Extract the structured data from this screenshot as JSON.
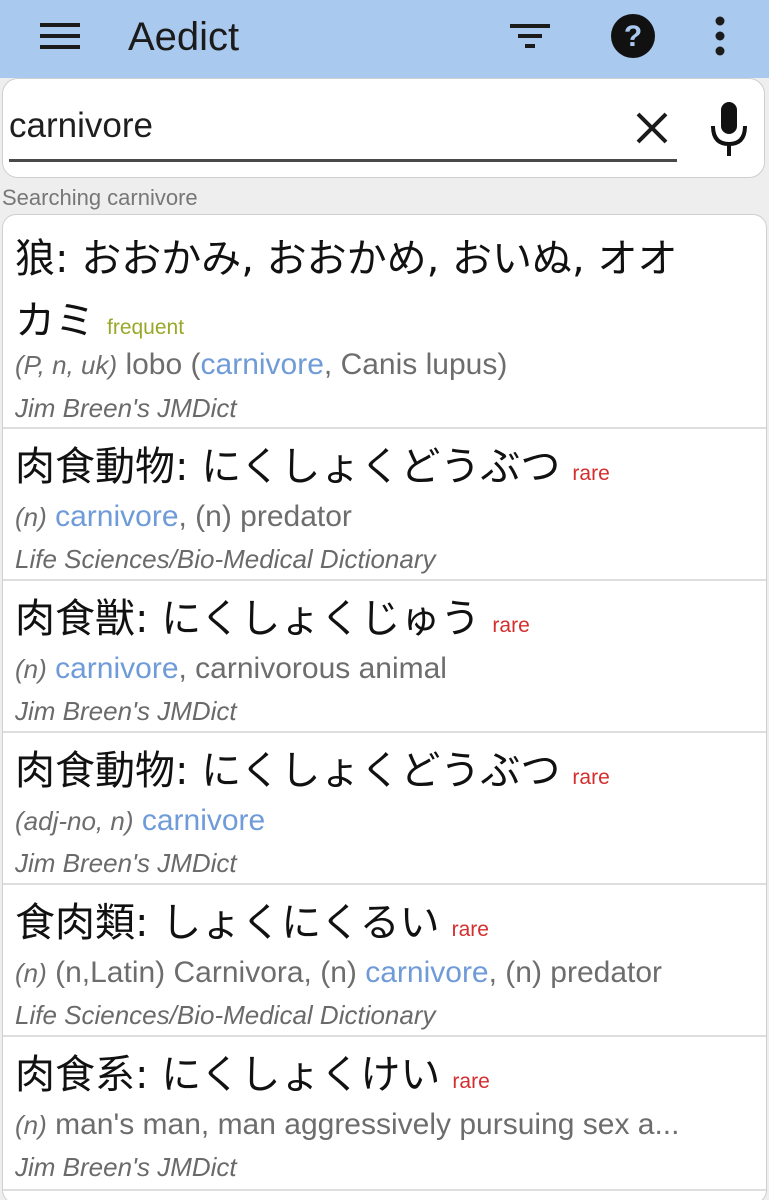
{
  "app": {
    "title": "Aedict"
  },
  "toolbar": {
    "menu_icon": "hamburger-menu-icon",
    "filter_icon": "filter-icon",
    "help_icon": "help-circle-icon",
    "overflow_icon": "more-vertical-icon"
  },
  "search": {
    "value": "carnivore",
    "clear_icon": "close-icon",
    "mic_icon": "microphone-icon"
  },
  "status": {
    "text": "Searching carnivore"
  },
  "results": [
    {
      "headword_line1": "狼: おおかみ, おおかめ, おいぬ, オオ",
      "headword_line2": "カミ",
      "badge": "frequent",
      "sense_pos": "(P, n, uk)",
      "sense_before": " lobo (",
      "sense_highlight": "carnivore",
      "sense_after": ", Canis lupus)",
      "source": "Jim Breen's JMDict"
    },
    {
      "headword_line1": "肉食動物: にくしょくどうぶつ",
      "badge": "rare",
      "sense_pos": "(n)",
      "sense_before": " ",
      "sense_highlight": "carnivore",
      "sense_after": ", (n) predator",
      "source": "Life Sciences/Bio-Medical Dictionary"
    },
    {
      "headword_line1": "肉食獣: にくしょくじゅう",
      "badge": "rare",
      "sense_pos": "(n)",
      "sense_before": " ",
      "sense_highlight": "carnivore",
      "sense_after": ", carnivorous animal",
      "source": "Jim Breen's JMDict"
    },
    {
      "headword_line1": "肉食動物: にくしょくどうぶつ",
      "badge": "rare",
      "sense_pos": "(adj-no, n)",
      "sense_before": " ",
      "sense_highlight": "carnivore",
      "sense_after": "",
      "source": "Jim Breen's JMDict"
    },
    {
      "headword_line1": "食肉類: しょくにくるい",
      "badge": "rare",
      "sense_pos": "(n)",
      "sense_before": " (n,Latin) Carnivora, (n) ",
      "sense_highlight": "carnivore",
      "sense_after": ", (n) predator",
      "source": "Life Sciences/Bio-Medical Dictionary"
    },
    {
      "headword_line1": "肉食系: にくしょくけい",
      "badge": "rare",
      "sense_pos": "(n)",
      "sense_before": " man's man, man aggressively pursuing sex a...",
      "sense_highlight": "",
      "sense_after": "",
      "source": "Jim Breen's JMDict"
    }
  ],
  "colors": {
    "appbar": "#a9c9ef",
    "highlight": "#6f9bd8",
    "rare": "#d32f2f",
    "frequent": "#9aa82a"
  }
}
